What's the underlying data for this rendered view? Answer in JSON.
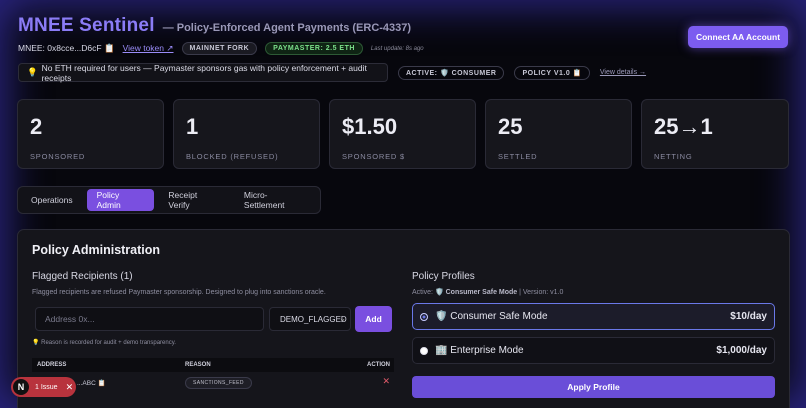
{
  "header": {
    "title": "MNEE Sentinel",
    "subtitle": "— Policy-Enforced Agent Payments (ERC-4337)",
    "connect_label": "Connect AA Account",
    "token_address": "MNEE: 0x8cce...D6cF",
    "copy_icon": "📋",
    "view_token": "View token ↗",
    "network_badge": "MAINNET FORK",
    "paymaster_badge": "PAYMASTER: 2.5 ETH",
    "last_update": "Last update: 8s ago",
    "info_icon": "💡",
    "info_text": "No ETH required for users — Paymaster sponsors gas with policy enforcement + audit receipts",
    "active_badge": "ACTIVE: 🛡️ CONSUMER",
    "policy_badge": "POLICY V1.0 📋",
    "view_details": "View details →"
  },
  "stats": [
    {
      "value": "2",
      "label": "SPONSORED"
    },
    {
      "value": "1",
      "label": "BLOCKED (REFUSED)"
    },
    {
      "value": "$1.50",
      "label": "SPONSORED $"
    },
    {
      "value": "25",
      "label": "SETTLED"
    },
    {
      "value": "25→1",
      "label": "NETTING"
    }
  ],
  "tabs": [
    "Operations",
    "Policy Admin",
    "Receipt Verify",
    "Micro-Settlement"
  ],
  "active_tab": "Policy Admin",
  "policy_admin": {
    "title": "Policy Administration",
    "flagged_title": "Flagged Recipients (1)",
    "flagged_desc": "Flagged recipients are refused Paymaster sponsorship. Designed to plug into sanctions oracle.",
    "address_placeholder": "Address 0x...",
    "reason_value": "DEMO_FLAGGED",
    "add_label": "Add",
    "note": "💡 Reason is recorded for audit + demo transparency.",
    "table_headers": {
      "address": "ADDRESS",
      "reason": "REASON",
      "action": "ACTION"
    },
    "rows": [
      {
        "address": "...ABC 📋",
        "reason": "SANCTIONS_FEED",
        "action": "✕"
      }
    ],
    "profiles_title": "Policy Profiles",
    "profiles_active_prefix": "Active: ",
    "profiles_active_name": "🛡️ Consumer Safe Mode",
    "profiles_active_suffix": " | Version: v1.0",
    "profiles": [
      {
        "name": "🛡️ Consumer Safe Mode",
        "limit": "$10/day",
        "selected": true
      },
      {
        "name": "🏢 Enterprise Mode",
        "limit": "$1,000/day",
        "selected": false
      }
    ],
    "apply_label": "Apply Profile"
  },
  "issue_badge": {
    "logo": "N",
    "text": "1 Issue",
    "close": "✕"
  },
  "colors": {
    "accent": "#7a4fe0",
    "title": "#8b7cf6",
    "success": "#7be08a",
    "danger": "#b8333d"
  }
}
